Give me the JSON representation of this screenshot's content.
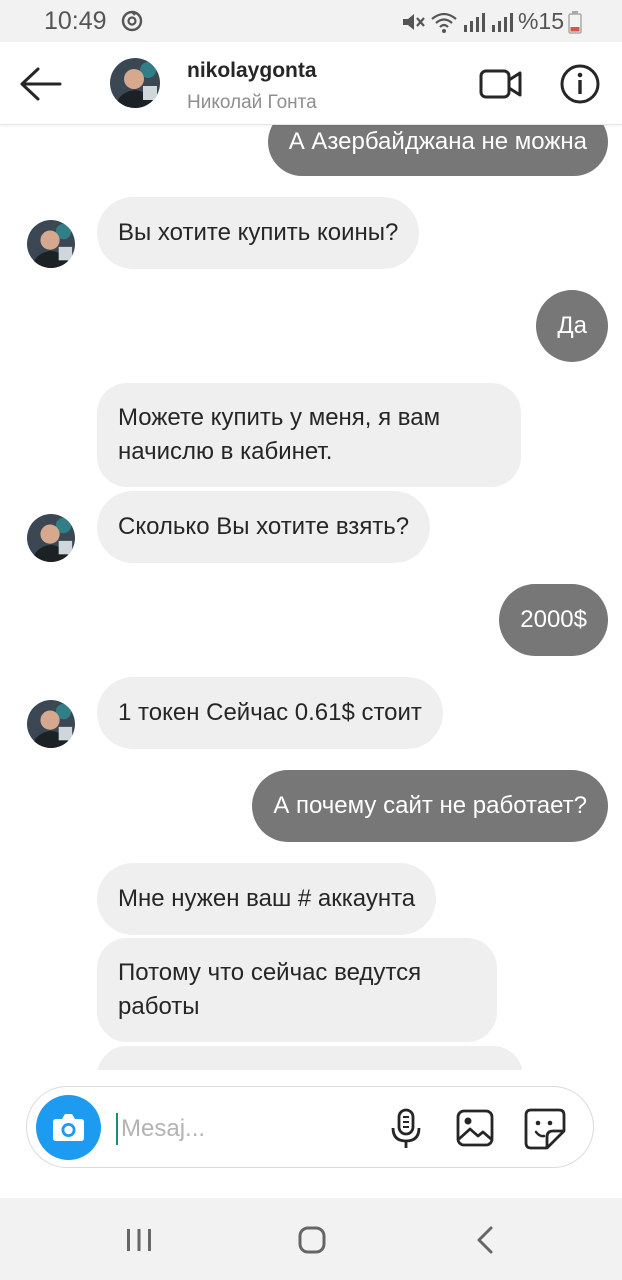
{
  "status_bar": {
    "time": "10:49",
    "battery": "%15",
    "icons": [
      "sync-icon",
      "mute-icon",
      "wifi-icon",
      "signal-icon",
      "signal-icon",
      "battery-icon"
    ]
  },
  "header": {
    "username": "nikolaygonta",
    "display_name": "Николай Гонта",
    "icons": [
      "back-arrow-icon",
      "video-camera-icon",
      "info-icon"
    ]
  },
  "messages": [
    {
      "side": "out",
      "text": "А Азербайджана не можна"
    },
    {
      "side": "in",
      "text": "Вы хотите купить коины?"
    },
    {
      "side": "out",
      "text": "Да"
    },
    {
      "side": "in",
      "text": "Можете купить у меня, я вам начислю в кабинет."
    },
    {
      "side": "in",
      "text": "Сколько Вы хотите взять?"
    },
    {
      "side": "out",
      "text": "2000$"
    },
    {
      "side": "in",
      "text": "1 токен Сейчас 0.61$ стоит"
    },
    {
      "side": "out",
      "text": "А почему сайт не работает?"
    },
    {
      "side": "in",
      "text": "Мне нужен ваш # аккаунта"
    },
    {
      "side": "in",
      "text": "Потому что сейчас ведутся работы"
    }
  ],
  "composer": {
    "placeholder": "Mesaj...",
    "icons": [
      "camera-icon",
      "microphone-icon",
      "gallery-icon",
      "sticker-icon"
    ]
  },
  "colors": {
    "incoming_bubble": "#efefef",
    "outgoing_bubble": "#777777",
    "camera_button": "#1d9bf0"
  },
  "nav_bar": {
    "icons": [
      "recent-apps-icon",
      "home-icon",
      "back-icon"
    ]
  }
}
